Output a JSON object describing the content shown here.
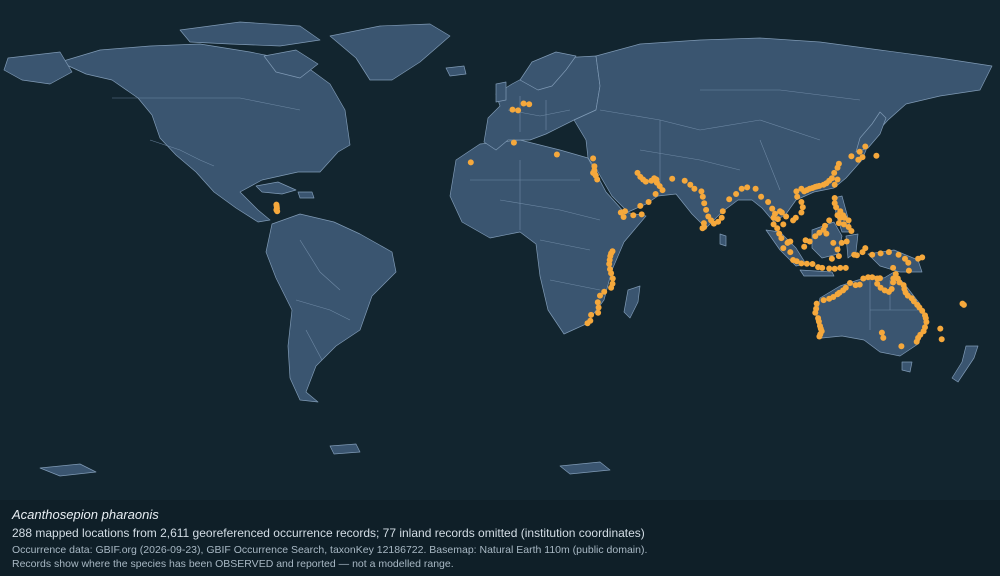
{
  "caption": {
    "species": "Acanthosepion pharaonis",
    "summary": "288 mapped locations from 2,611 georeferenced occurrence records; 77 inland records omitted (institution coordinates)",
    "source": "Occurrence data: GBIF.org (2026-09-23), GBIF Occurrence Search, taxonKey 12186722. Basemap: Natural Earth 110m (public domain).",
    "note": "Records show where the species has been OBSERVED and reported — not a modelled range."
  },
  "colors": {
    "ocean": "#12252f",
    "land": "#3a5570",
    "borders": "#7f9ab5",
    "occurrence": "#f5a83c"
  },
  "occurrences": [
    [
      -80.5,
      15.5
    ],
    [
      -80.4,
      14.8
    ],
    [
      -80.3,
      14.1
    ],
    [
      -80.5,
      13.5
    ],
    [
      -80.2,
      13.0
    ],
    [
      10.5,
      53.5
    ],
    [
      8.5,
      53.8
    ],
    [
      6.5,
      51.2
    ],
    [
      4.5,
      51.5
    ],
    [
      5.0,
      39.0
    ],
    [
      20.5,
      34.5
    ],
    [
      -10.5,
      31.5
    ],
    [
      33.5,
      33.0
    ],
    [
      34.0,
      30.0
    ],
    [
      33.5,
      27.5
    ],
    [
      34.0,
      28.5
    ],
    [
      34.5,
      26.5
    ],
    [
      35.0,
      25.0
    ],
    [
      34.2,
      27.0
    ],
    [
      49.5,
      27.5
    ],
    [
      50.5,
      26.0
    ],
    [
      51.5,
      25.0
    ],
    [
      52.5,
      24.2
    ],
    [
      54.5,
      24.5
    ],
    [
      55.5,
      25.5
    ],
    [
      56.3,
      25.0
    ],
    [
      56.5,
      23.8
    ],
    [
      57.5,
      22.5
    ],
    [
      58.5,
      21.0
    ],
    [
      56.0,
      19.5
    ],
    [
      53.5,
      16.5
    ],
    [
      50.5,
      15.0
    ],
    [
      45.0,
      13.0
    ],
    [
      43.5,
      12.5
    ],
    [
      44.5,
      10.8
    ],
    [
      48.0,
      11.5
    ],
    [
      51.0,
      11.8
    ],
    [
      62.0,
      25.3
    ],
    [
      66.5,
      24.5
    ],
    [
      68.5,
      23.0
    ],
    [
      70.0,
      21.5
    ],
    [
      72.5,
      20.5
    ],
    [
      73.0,
      18.5
    ],
    [
      73.5,
      16.0
    ],
    [
      74.2,
      13.5
    ],
    [
      75.0,
      11.0
    ],
    [
      76.0,
      9.5
    ],
    [
      77.0,
      8.3
    ],
    [
      78.5,
      9.0
    ],
    [
      79.8,
      10.5
    ],
    [
      80.2,
      13.0
    ],
    [
      73.4,
      8.5
    ],
    [
      72.9,
      6.5
    ],
    [
      73.5,
      7.0
    ],
    [
      82.5,
      17.5
    ],
    [
      85.0,
      19.5
    ],
    [
      87.0,
      21.5
    ],
    [
      89.0,
      22.0
    ],
    [
      92.0,
      21.5
    ],
    [
      94.0,
      18.5
    ],
    [
      96.5,
      16.5
    ],
    [
      98.0,
      14.0
    ],
    [
      98.5,
      10.5
    ],
    [
      98.5,
      8.0
    ],
    [
      99.8,
      6.5
    ],
    [
      100.5,
      4.5
    ],
    [
      101.3,
      2.8
    ],
    [
      103.8,
      1.3
    ],
    [
      104.5,
      1.5
    ],
    [
      101.5,
      12.5
    ],
    [
      103.0,
      11.0
    ],
    [
      100.8,
      13.0
    ],
    [
      99.0,
      12.0
    ],
    [
      100.0,
      10.0
    ],
    [
      102.0,
      8.0
    ],
    [
      105.5,
      9.5
    ],
    [
      106.5,
      10.5
    ],
    [
      108.5,
      12.5
    ],
    [
      109.0,
      14.5
    ],
    [
      108.5,
      16.5
    ],
    [
      107.0,
      18.5
    ],
    [
      106.7,
      20.5
    ],
    [
      108.5,
      21.5
    ],
    [
      109.5,
      20.5
    ],
    [
      110.5,
      21.0
    ],
    [
      111.5,
      21.5
    ],
    [
      112.5,
      21.8
    ],
    [
      113.5,
      22.2
    ],
    [
      114.2,
      22.4
    ],
    [
      115.0,
      22.6
    ],
    [
      116.5,
      23.0
    ],
    [
      117.5,
      23.6
    ],
    [
      118.5,
      24.5
    ],
    [
      119.5,
      25.5
    ],
    [
      120.3,
      27.5
    ],
    [
      121.5,
      29.5
    ],
    [
      122.0,
      31.0
    ],
    [
      121.5,
      25.0
    ],
    [
      120.5,
      23.0
    ],
    [
      126.5,
      33.8
    ],
    [
      129.5,
      35.5
    ],
    [
      130.5,
      33.5
    ],
    [
      129.0,
      32.5
    ],
    [
      135.5,
      34.0
    ],
    [
      131.5,
      37.5
    ],
    [
      120.5,
      18.0
    ],
    [
      120.5,
      16.0
    ],
    [
      121.0,
      14.5
    ],
    [
      122.5,
      13.0
    ],
    [
      123.5,
      11.5
    ],
    [
      124.0,
      10.5
    ],
    [
      122.5,
      10.5
    ],
    [
      122.0,
      8.5
    ],
    [
      123.8,
      8.0
    ],
    [
      125.5,
      9.5
    ],
    [
      125.5,
      7.0
    ],
    [
      121.5,
      11.5
    ],
    [
      118.5,
      9.5
    ],
    [
      117.0,
      7.5
    ],
    [
      116.5,
      6.0
    ],
    [
      115.0,
      4.8
    ],
    [
      113.5,
      3.5
    ],
    [
      111.5,
      1.5
    ],
    [
      109.5,
      -0.5
    ],
    [
      110.0,
      2.0
    ],
    [
      103.5,
      1.0
    ],
    [
      102.0,
      -1.0
    ],
    [
      104.5,
      -2.5
    ],
    [
      105.5,
      -5.5
    ],
    [
      106.8,
      -6.0
    ],
    [
      108.5,
      -6.8
    ],
    [
      110.5,
      -6.9
    ],
    [
      112.5,
      -7.0
    ],
    [
      114.5,
      -8.2
    ],
    [
      116.0,
      -8.5
    ],
    [
      118.5,
      -8.7
    ],
    [
      120.5,
      -8.8
    ],
    [
      122.5,
      -8.5
    ],
    [
      124.5,
      -8.5
    ],
    [
      119.5,
      -5.0
    ],
    [
      122.0,
      -4.0
    ],
    [
      121.5,
      -1.5
    ],
    [
      123.0,
      1.0
    ],
    [
      124.8,
      1.5
    ],
    [
      127.5,
      -3.5
    ],
    [
      128.5,
      -3.7
    ],
    [
      130.5,
      -2.5
    ],
    [
      131.5,
      -1.0
    ],
    [
      134.0,
      -3.5
    ],
    [
      137.0,
      -3.0
    ],
    [
      140.0,
      -2.5
    ],
    [
      143.5,
      -3.5
    ],
    [
      145.8,
      -5.0
    ],
    [
      147.0,
      -6.5
    ],
    [
      150.5,
      -5.0
    ],
    [
      152.0,
      -4.5
    ],
    [
      147.2,
      -9.5
    ],
    [
      141.5,
      -8.5
    ],
    [
      117.5,
      4.5
    ],
    [
      126.5,
      5.5
    ],
    [
      120.0,
      1.0
    ],
    [
      114.0,
      -22.0
    ],
    [
      113.8,
      -24.0
    ],
    [
      113.5,
      -25.5
    ],
    [
      114.5,
      -27.5
    ],
    [
      114.8,
      -28.8
    ],
    [
      115.2,
      -30.5
    ],
    [
      115.5,
      -31.5
    ],
    [
      115.8,
      -32.5
    ],
    [
      115.3,
      -33.6
    ],
    [
      116.5,
      -20.7
    ],
    [
      118.5,
      -20.2
    ],
    [
      120.0,
      -19.5
    ],
    [
      121.5,
      -18.5
    ],
    [
      122.2,
      -17.9
    ],
    [
      123.5,
      -17.0
    ],
    [
      124.5,
      -16.0
    ],
    [
      126.0,
      -14.2
    ],
    [
      128.0,
      -15.0
    ],
    [
      129.5,
      -14.8
    ],
    [
      130.8,
      -12.5
    ],
    [
      132.5,
      -12.0
    ],
    [
      134.0,
      -12.0
    ],
    [
      135.8,
      -12.5
    ],
    [
      136.8,
      -12.4
    ],
    [
      135.8,
      -14.5
    ],
    [
      137.0,
      -16.0
    ],
    [
      138.5,
      -17.0
    ],
    [
      140.0,
      -17.6
    ],
    [
      141.0,
      -16.5
    ],
    [
      141.5,
      -14.0
    ],
    [
      141.6,
      -12.5
    ],
    [
      142.5,
      -10.8
    ],
    [
      143.2,
      -12.5
    ],
    [
      143.8,
      -14.0
    ],
    [
      145.3,
      -15.0
    ],
    [
      145.6,
      -16.5
    ],
    [
      146.0,
      -17.8
    ],
    [
      146.8,
      -19.0
    ],
    [
      148.2,
      -20.0
    ],
    [
      149.0,
      -21.2
    ],
    [
      150.2,
      -22.5
    ],
    [
      151.0,
      -23.5
    ],
    [
      152.0,
      -24.8
    ],
    [
      153.0,
      -26.5
    ],
    [
      153.3,
      -27.5
    ],
    [
      153.5,
      -29.0
    ],
    [
      153.0,
      -31.0
    ],
    [
      152.5,
      -32.5
    ],
    [
      151.3,
      -33.8
    ],
    [
      150.5,
      -35.0
    ],
    [
      150.0,
      -36.5
    ],
    [
      144.5,
      -38.2
    ],
    [
      158.5,
      -31.5
    ],
    [
      159.0,
      -35.5
    ],
    [
      166.5,
      -22.0
    ],
    [
      167.0,
      -22.5
    ],
    [
      138.0,
      -35.0
    ],
    [
      137.5,
      -33.0
    ],
    [
      115.0,
      -34.5
    ],
    [
      40.0,
      -3.0
    ],
    [
      40.5,
      -2.2
    ],
    [
      39.7,
      -4.0
    ],
    [
      39.5,
      -5.5
    ],
    [
      39.3,
      -7.0
    ],
    [
      39.6,
      -9.0
    ],
    [
      40.0,
      -10.5
    ],
    [
      40.6,
      -12.5
    ],
    [
      40.5,
      -14.5
    ],
    [
      40.0,
      -16.0
    ],
    [
      37.5,
      -17.5
    ],
    [
      36.0,
      -19.0
    ],
    [
      35.2,
      -21.5
    ],
    [
      35.5,
      -23.5
    ],
    [
      35.3,
      -25.5
    ],
    [
      32.8,
      -26.3
    ],
    [
      32.5,
      -28.5
    ],
    [
      31.5,
      -29.5
    ]
  ]
}
